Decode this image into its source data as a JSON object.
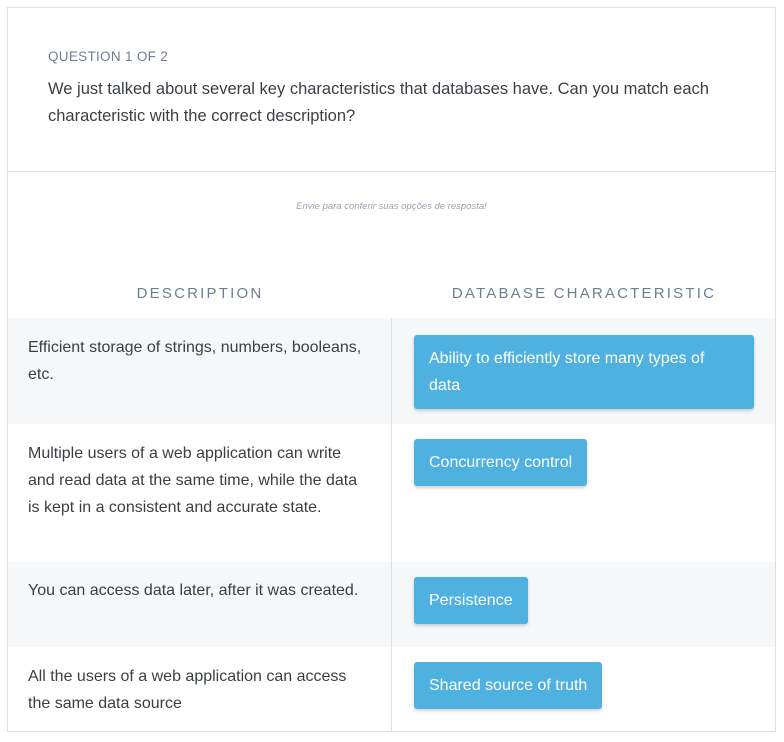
{
  "question": {
    "label": "QUESTION 1 OF 2",
    "text": "We just talked about several key characteristics that databases have. Can you match each characteristic with the correct description?"
  },
  "hint": "Envie para conferir suas opções de resposta!",
  "columns": {
    "description": "DESCRIPTION",
    "characteristic": "DATABASE CHARACTERISTIC"
  },
  "rows": [
    {
      "description": "Efficient storage of strings, numbers, booleans, etc.",
      "answer": "Ability to efficiently store many types of data"
    },
    {
      "description": "Multiple users of a web application can write and read data at the same time, while the data is kept in a consistent and accurate state.",
      "answer": "Concurrency control"
    },
    {
      "description": "You can access data later, after it was created.",
      "answer": "Persistence"
    },
    {
      "description": "All the users of a web application can access the same data source",
      "answer": "Shared source of truth"
    }
  ],
  "colors": {
    "chip": "#4fb1e0",
    "row_shade": "#f6f7f9",
    "label": "#6f7e90",
    "text": "#3a3f44"
  }
}
